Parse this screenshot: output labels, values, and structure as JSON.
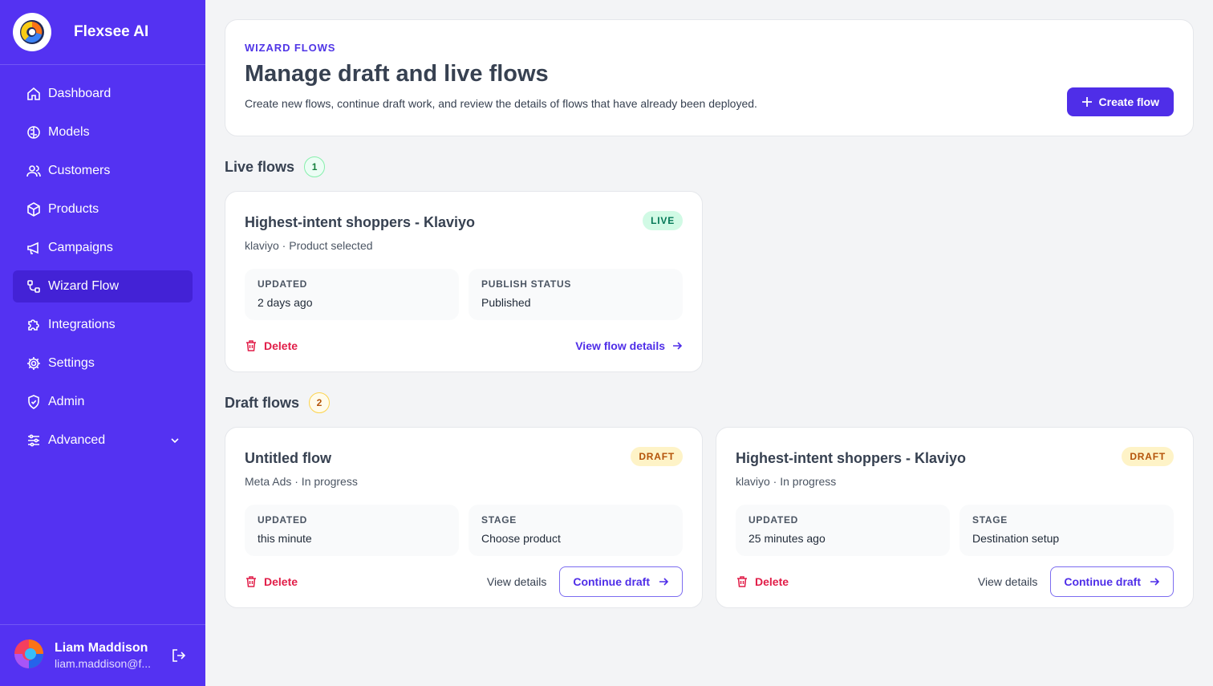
{
  "brand": {
    "name": "Flexsee AI"
  },
  "nav": {
    "items": [
      {
        "label": "Dashboard"
      },
      {
        "label": "Models"
      },
      {
        "label": "Customers"
      },
      {
        "label": "Products"
      },
      {
        "label": "Campaigns"
      },
      {
        "label": "Wizard Flow",
        "active": true
      },
      {
        "label": "Integrations"
      },
      {
        "label": "Settings"
      },
      {
        "label": "Admin"
      },
      {
        "label": "Advanced"
      }
    ]
  },
  "user": {
    "name": "Liam Maddison",
    "email": "liam.maddison@f..."
  },
  "header": {
    "eyebrow": "WIZARD FLOWS",
    "title": "Manage draft and live flows",
    "subtitle": "Create new flows, continue draft work, and review the details of flows that have already been deployed.",
    "create_label": "Create flow"
  },
  "live": {
    "title": "Live flows",
    "count": "1",
    "cards": [
      {
        "title": "Highest-intent shoppers - Klaviyo",
        "meta": "klaviyo · Product selected",
        "badge": "LIVE",
        "stat1_label": "UPDATED",
        "stat1_value": "2 days ago",
        "stat2_label": "PUBLISH STATUS",
        "stat2_value": "Published",
        "delete_label": "Delete",
        "view_label": "View flow details"
      }
    ]
  },
  "draft": {
    "title": "Draft flows",
    "count": "2",
    "cards": [
      {
        "title": "Untitled flow",
        "meta": "Meta Ads · In progress",
        "badge": "DRAFT",
        "stat1_label": "UPDATED",
        "stat1_value": "this minute",
        "stat2_label": "STAGE",
        "stat2_value": "Choose product",
        "delete_label": "Delete",
        "view_label": "View details",
        "continue_label": "Continue draft"
      },
      {
        "title": "Highest-intent shoppers - Klaviyo",
        "meta": "klaviyo · In progress",
        "badge": "DRAFT",
        "stat1_label": "UPDATED",
        "stat1_value": "25 minutes ago",
        "stat2_label": "STAGE",
        "stat2_value": "Destination setup",
        "delete_label": "Delete",
        "view_label": "View details",
        "continue_label": "Continue draft"
      }
    ]
  },
  "colors": {
    "sidebar": "#5432f2",
    "accent": "#4f2ee8",
    "danger": "#e11d48",
    "live": "#047857",
    "draft": "#b45309"
  }
}
